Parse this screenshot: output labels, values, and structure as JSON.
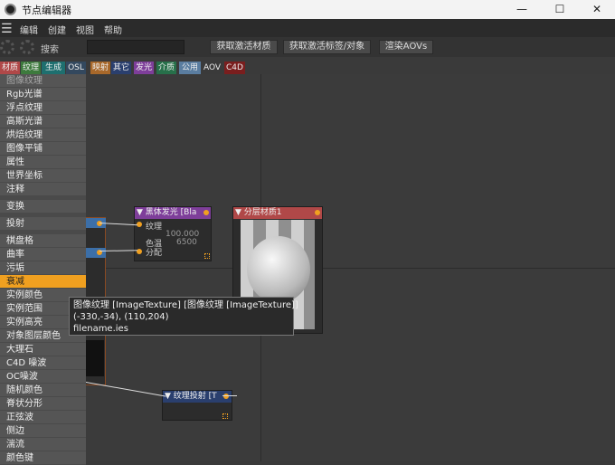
{
  "window": {
    "title": "节点编辑器",
    "minimize": "—",
    "maximize": "☐",
    "close": "✕"
  },
  "menubar": {
    "items": [
      "编辑",
      "创建",
      "视图",
      "帮助"
    ]
  },
  "toolbar": {
    "search_label": "搜索",
    "search_value": "",
    "buttons": [
      "获取激活材质",
      "获取激活标签/对象",
      "渲染AOVs"
    ]
  },
  "filters": [
    {
      "label": "材质",
      "color": "#b04848"
    },
    {
      "label": "纹理",
      "color": "#3d7a3d"
    },
    {
      "label": "生成",
      "color": "#1e6f6f"
    },
    {
      "label": "OSL",
      "color": "#33485e"
    },
    {
      "label": "映射",
      "color": "#a8682a"
    },
    {
      "label": "其它",
      "color": "#2a3f6e"
    },
    {
      "label": "发光",
      "color": "#7e3e9a"
    },
    {
      "label": "介质",
      "color": "#27704a"
    },
    {
      "label": "公用",
      "color": "#5a7da0"
    },
    {
      "label": "AOV",
      "color": "#3a3a3a"
    },
    {
      "label": "C4D",
      "color": "#7a1e1e"
    }
  ],
  "context_menu": {
    "group1": [
      "图像纹理",
      "Rgb光谱",
      "浮点纹理",
      "高斯光谱",
      "烘焙纹理",
      "图像平铺",
      "属性",
      "世界坐标",
      "注释"
    ],
    "group2": [
      "变换"
    ],
    "group3": [
      "投射"
    ],
    "group4": [
      "棋盘格",
      "曲率",
      "污垢",
      "衰减",
      "实例颜色",
      "实例范围",
      "实例高亮",
      "对象图层颜色",
      "大理石",
      "C4D 噪波",
      "OC噪波",
      "随机颜色",
      "脊状分形",
      "正弦波",
      "侧边",
      "湍流",
      "颜色键"
    ],
    "selected": "衰减"
  },
  "nodes": {
    "blackbody": {
      "title": "黑体发光 [Bla",
      "ports": [
        "纹理",
        "色温",
        "分配"
      ],
      "values": [
        "100.000",
        "6500"
      ]
    },
    "layered": {
      "title": "分层材质1"
    },
    "projection": {
      "title": "纹理投射 [T"
    }
  },
  "tooltip": {
    "line1": "图像纹理 [ImageTexture] [图像纹理 [ImageTexture]]",
    "line2": "(-330,-34), (110,204)",
    "line3": "filename.ies"
  }
}
